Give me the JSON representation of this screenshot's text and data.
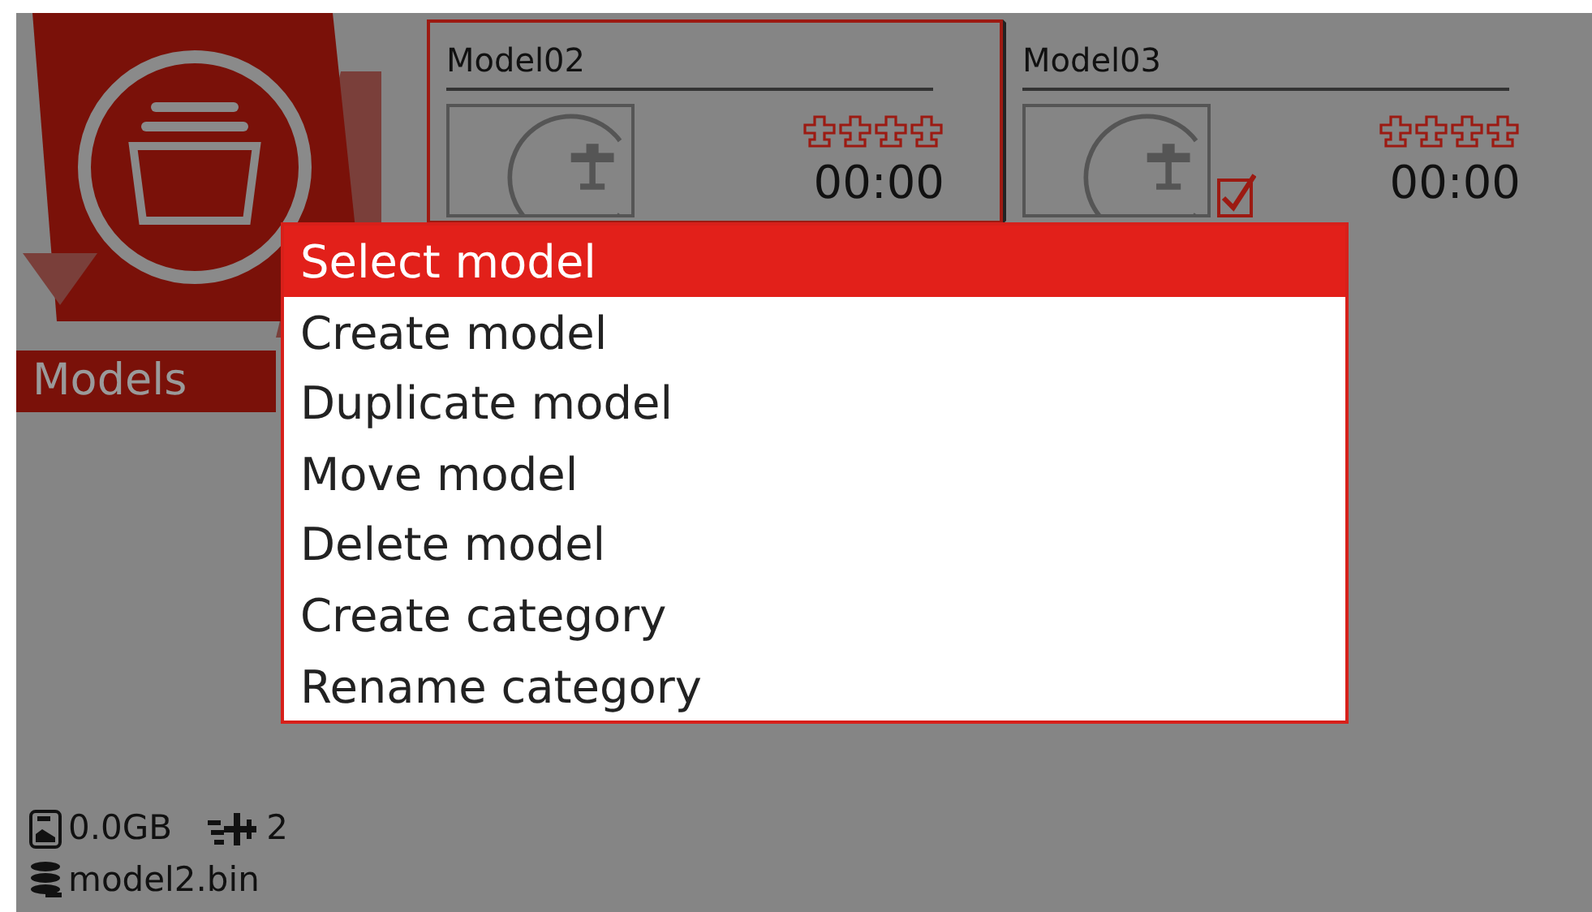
{
  "page_title": "Models",
  "models": [
    {
      "name": "Model02",
      "selected": true,
      "current": false,
      "timer": "00:00"
    },
    {
      "name": "Model03",
      "selected": false,
      "current": true,
      "timer": "00:00"
    }
  ],
  "menu": [
    {
      "label": "Select model",
      "selected": true
    },
    {
      "label": "Create model",
      "selected": false
    },
    {
      "label": "Duplicate model",
      "selected": false
    },
    {
      "label": "Move model",
      "selected": false
    },
    {
      "label": "Delete model",
      "selected": false
    },
    {
      "label": "Create category",
      "selected": false
    },
    {
      "label": "Rename category",
      "selected": false
    }
  ],
  "status": {
    "storage": "0.0GB",
    "model_count": "2",
    "file": "model2.bin"
  }
}
